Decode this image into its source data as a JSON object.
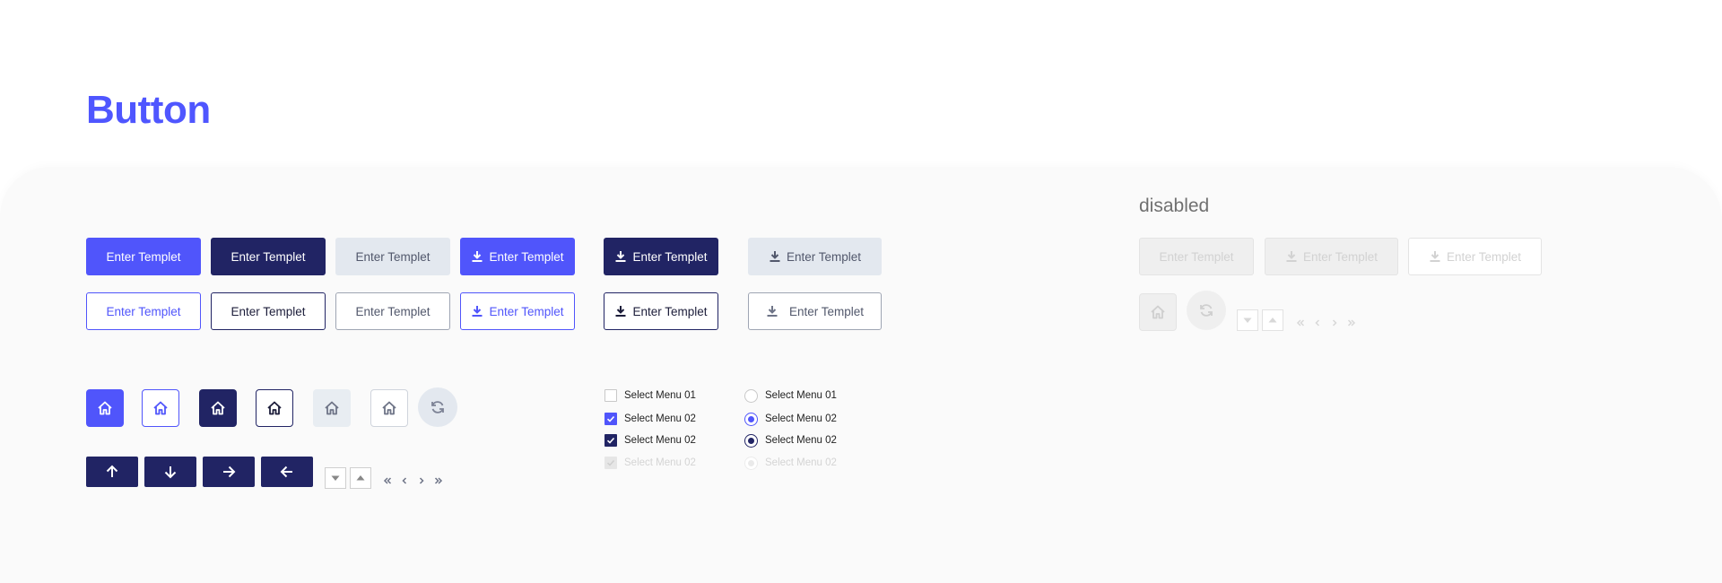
{
  "page": {
    "title": "Button"
  },
  "disabled_section": {
    "label": "disabled",
    "buttons": [
      {
        "label": "Enter Templet",
        "icon": "none"
      },
      {
        "label": "Enter Templet",
        "icon": "download-icon"
      },
      {
        "label": "Enter Templet",
        "icon": "download-icon"
      }
    ]
  },
  "buttons": {
    "filled_row": [
      {
        "label": "Enter Templet",
        "variant": "primary"
      },
      {
        "label": "Enter Templet",
        "variant": "dark"
      },
      {
        "label": "Enter Templet",
        "variant": "light"
      },
      {
        "label": "Enter Templet",
        "variant": "primary",
        "icon": "download-icon"
      },
      {
        "label": "Enter Templet",
        "variant": "dark",
        "icon": "download-icon"
      },
      {
        "label": "Enter Templet",
        "variant": "light",
        "icon": "download-icon"
      }
    ],
    "outline_row": [
      {
        "label": "Enter Templet",
        "variant": "outline-primary"
      },
      {
        "label": "Enter Templet",
        "variant": "outline-dark"
      },
      {
        "label": "Enter Templet",
        "variant": "outline-light"
      },
      {
        "label": "Enter Templet",
        "variant": "outline-primary",
        "icon": "download-icon"
      },
      {
        "label": "Enter Templet",
        "variant": "outline-dark",
        "icon": "download-icon"
      },
      {
        "label": "Enter Templet",
        "variant": "outline-light",
        "icon": "download-icon"
      }
    ]
  },
  "icon_buttons": [
    "home-icon",
    "home-icon",
    "home-icon",
    "home-icon",
    "home-icon",
    "home-icon",
    "refresh-icon"
  ],
  "arrow_buttons": [
    "arrow-up-icon",
    "arrow-down-icon",
    "arrow-right-icon",
    "arrow-left-icon"
  ],
  "small_controls": [
    "triangle-down-icon",
    "triangle-up-icon"
  ],
  "pagination_icons": [
    "double-chevron-left-icon",
    "chevron-left-icon",
    "chevron-right-icon",
    "double-chevron-right-icon"
  ],
  "checkboxes": [
    {
      "label": "Select Menu 01",
      "state": "unchecked"
    },
    {
      "label": "Select Menu 02",
      "state": "checked-primary"
    },
    {
      "label": "Select Menu 02",
      "state": "checked-dark"
    },
    {
      "label": "Select Menu 02",
      "state": "disabled"
    }
  ],
  "radios": [
    {
      "label": "Select Menu 01",
      "state": "unchecked"
    },
    {
      "label": "Select Menu 02",
      "state": "checked-primary"
    },
    {
      "label": "Select Menu 02",
      "state": "checked-dark"
    },
    {
      "label": "Select Menu 02",
      "state": "disabled"
    }
  ],
  "colors": {
    "primary": "#5055fb",
    "dark": "#212464",
    "light": "#e3e8ef",
    "title": "#4f56ff",
    "disabled": "#efefef"
  }
}
